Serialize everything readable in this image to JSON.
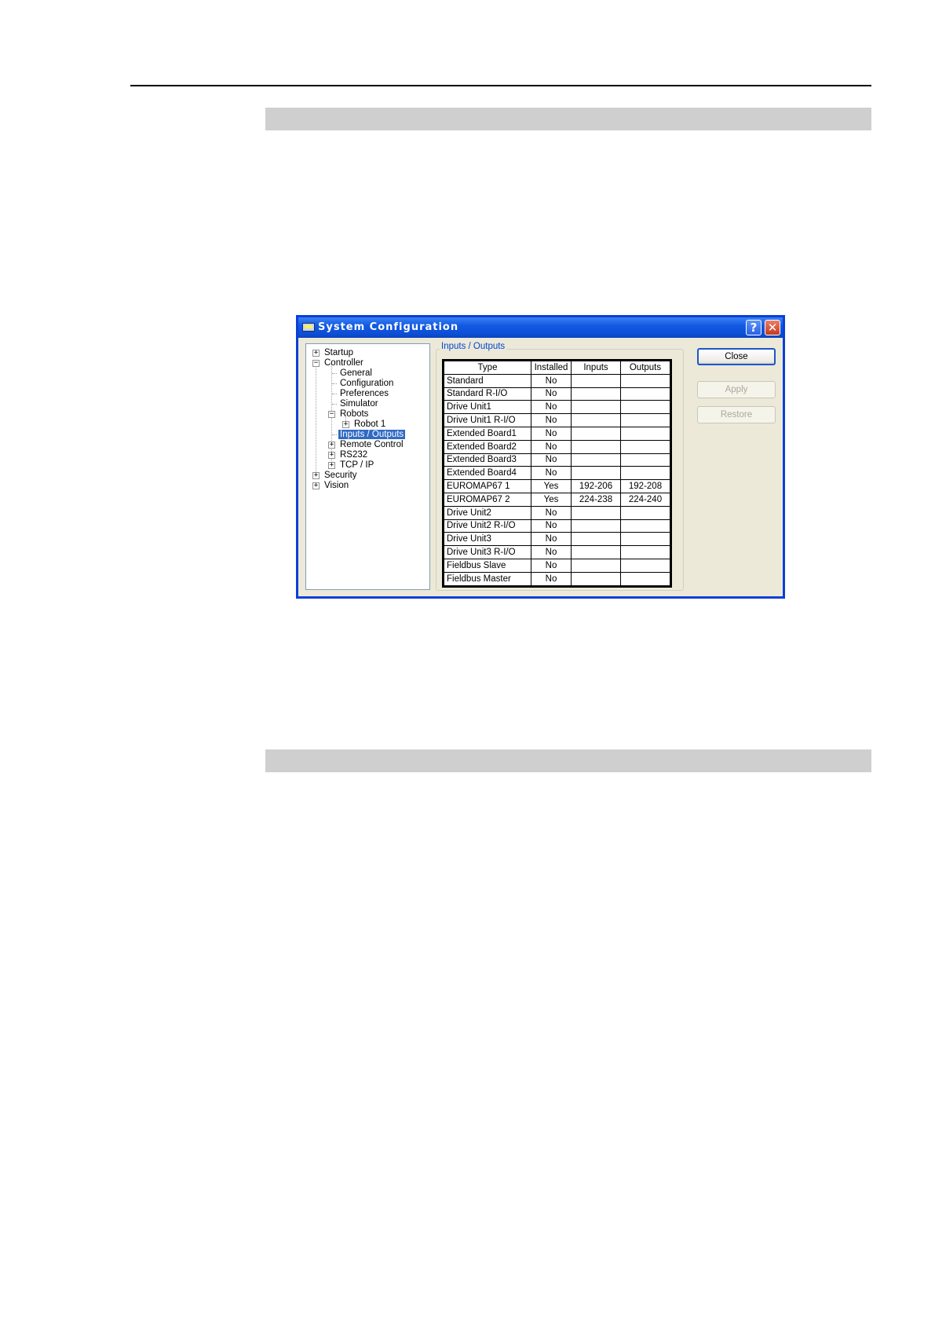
{
  "dialog": {
    "title": "System Configuration",
    "help_label": "?",
    "close_label": "✕",
    "group_label": "Inputs / Outputs",
    "buttons": {
      "close": "Close",
      "apply": "Apply",
      "restore": "Restore"
    }
  },
  "tree": [
    {
      "label": "Startup",
      "expander": "+"
    },
    {
      "label": "Controller",
      "expander": "−"
    },
    {
      "label": "General"
    },
    {
      "label": "Configuration"
    },
    {
      "label": "Preferences"
    },
    {
      "label": "Simulator"
    },
    {
      "label": "Robots",
      "expander": "−"
    },
    {
      "label": "Robot 1",
      "expander": "+"
    },
    {
      "label": "Inputs / Outputs",
      "selected": true
    },
    {
      "label": "Remote Control",
      "expander": "+"
    },
    {
      "label": "RS232",
      "expander": "+"
    },
    {
      "label": "TCP / IP",
      "expander": "+"
    },
    {
      "label": "Security",
      "expander": "+"
    },
    {
      "label": "Vision",
      "expander": "+"
    }
  ],
  "table": {
    "headers": [
      "Type",
      "Installed",
      "Inputs",
      "Outputs"
    ],
    "rows": [
      [
        "Standard",
        "No",
        "",
        ""
      ],
      [
        "Standard R-I/O",
        "No",
        "",
        ""
      ],
      [
        "Drive Unit1",
        "No",
        "",
        ""
      ],
      [
        "Drive Unit1 R-I/O",
        "No",
        "",
        ""
      ],
      [
        "Extended Board1",
        "No",
        "",
        ""
      ],
      [
        "Extended Board2",
        "No",
        "",
        ""
      ],
      [
        "Extended Board3",
        "No",
        "",
        ""
      ],
      [
        "Extended Board4",
        "No",
        "",
        ""
      ],
      [
        "EUROMAP67 1",
        "Yes",
        "192-206",
        "192-208"
      ],
      [
        "EUROMAP67 2",
        "Yes",
        "224-238",
        "224-240"
      ],
      [
        "Drive Unit2",
        "No",
        "",
        ""
      ],
      [
        "Drive Unit2 R-I/O",
        "No",
        "",
        ""
      ],
      [
        "Drive Unit3",
        "No",
        "",
        ""
      ],
      [
        "Drive Unit3 R-I/O",
        "No",
        "",
        ""
      ],
      [
        "Fieldbus Slave",
        "No",
        "",
        ""
      ],
      [
        "Fieldbus Master",
        "No",
        "",
        ""
      ]
    ]
  }
}
